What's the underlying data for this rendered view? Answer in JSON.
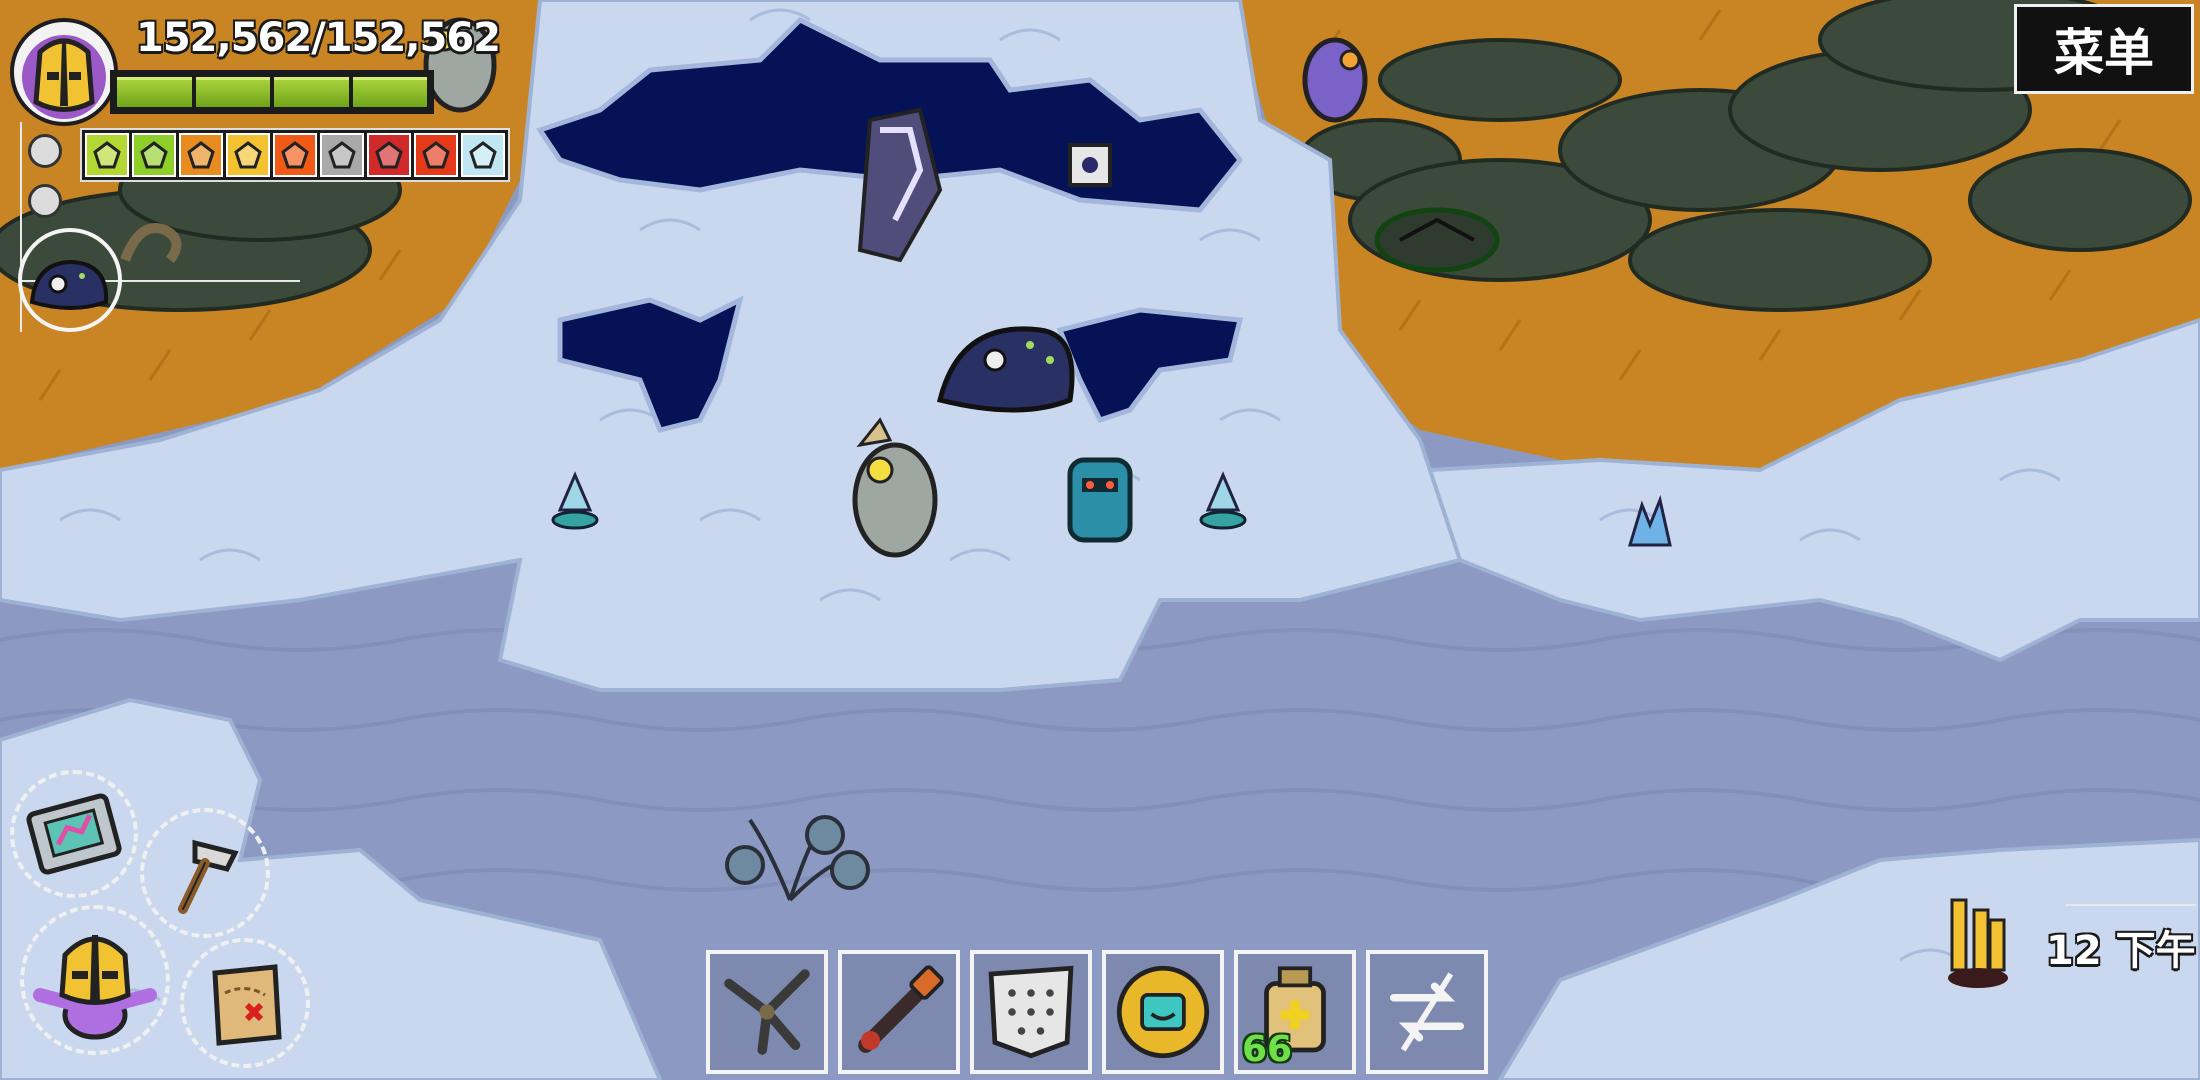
{
  "player": {
    "health_text": "152,562/152,562",
    "health_fraction": 1.0
  },
  "hud": {
    "menu_label": "菜单",
    "clock_text": "12 下午"
  },
  "buffs": [
    {
      "icon": "green-splat-icon",
      "color": "#b3d833"
    },
    {
      "icon": "green-shield-icon",
      "color": "#8fcf2a"
    },
    {
      "icon": "orange-shield-icon",
      "color": "#e98c1f"
    },
    {
      "icon": "star-icon",
      "color": "#f2c230"
    },
    {
      "icon": "fire-icon",
      "color": "#f05a16"
    },
    {
      "icon": "grey-shield-icon",
      "color": "#a9a9a9"
    },
    {
      "icon": "fangs-icon",
      "color": "#d12a2a"
    },
    {
      "icon": "red-slash-icon",
      "color": "#e53a1a"
    },
    {
      "icon": "ice-shield-icon",
      "color": "#bfe6f2"
    }
  ],
  "quick_actions": [
    {
      "name": "build-menu-button",
      "icon": "blueprint-device-icon"
    },
    {
      "name": "crafting-button",
      "icon": "hammer-icon"
    },
    {
      "name": "character-button",
      "icon": "character-icon"
    },
    {
      "name": "quests-map-button",
      "icon": "treasure-map-icon"
    }
  ],
  "hotbar": [
    {
      "icon": "tripod-weapon-icon",
      "quantity": ""
    },
    {
      "icon": "torch-icon",
      "quantity": ""
    },
    {
      "icon": "shield-pad-icon",
      "quantity": ""
    },
    {
      "icon": "golden-badge-icon",
      "quantity": ""
    },
    {
      "icon": "potion-jar-icon",
      "quantity": "66"
    },
    {
      "icon": "swap-arrows-icon",
      "quantity": ""
    }
  ],
  "colors": {
    "snow": "#c9d8ef",
    "water": "#8c9ac3",
    "void": "#061256",
    "grass": "#c98523",
    "rock": "#3c4a3c"
  }
}
